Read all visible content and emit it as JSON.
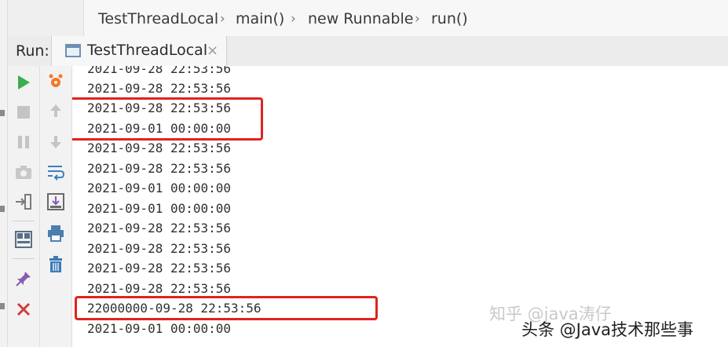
{
  "breadcrumb": {
    "items": [
      "TestThreadLocal",
      "main()",
      "new Runnable",
      "run()"
    ],
    "separator": "›"
  },
  "run_panel": {
    "label": "Run:",
    "tab_title": "TestThreadLocal",
    "tab_close": "×"
  },
  "toolbar_left": [
    {
      "icon": "run-icon",
      "color": "#3cae4c"
    },
    {
      "icon": "stop-icon",
      "color": "#b8b8b8"
    },
    {
      "icon": "pause-icon",
      "color": "#b8b8b8"
    },
    {
      "icon": "camera-icon",
      "color": "#b8b8b8"
    },
    {
      "icon": "login-icon",
      "color": "#777777"
    },
    {
      "icon": "layout-icon",
      "color": "#5a6f86"
    },
    {
      "icon": "pin-icon",
      "color": "#8a5ab0"
    },
    {
      "icon": "close-icon",
      "color": "#d23c3c"
    }
  ],
  "toolbar_right": [
    {
      "icon": "debug-icon",
      "color": "#f07a28"
    },
    {
      "icon": "up-arrow-icon",
      "color": "#b8b8b8"
    },
    {
      "icon": "down-arrow-icon",
      "color": "#b8b8b8"
    },
    {
      "icon": "soft-wrap-icon",
      "color": "#3f7fbf"
    },
    {
      "icon": "scroll-to-end-icon",
      "color": "#6a6a6a"
    },
    {
      "icon": "print-icon",
      "color": "#4a7fb0"
    },
    {
      "icon": "trash-icon",
      "color": "#3d7ab8"
    }
  ],
  "console": {
    "lines": [
      "2021-09-28 22:53:56",
      "2021-09-28 22:53:56",
      "2021-09-28 22:53:56",
      "2021-09-01 00:00:00",
      "2021-09-28 22:53:56",
      "2021-09-28 22:53:56",
      "2021-09-01 00:00:00",
      "2021-09-01 00:00:00",
      "2021-09-28 22:53:56",
      "2021-09-28 22:53:56",
      "2021-09-28 22:53:56",
      "2021-09-28 22:53:56",
      "22000000-09-28 22:53:56",
      "2021-09-01 00:00:00"
    ],
    "highlight_color": "#e0231f"
  },
  "watermarks": {
    "zhihu": "知乎 @java涛仔",
    "toutiao": "头条 @Java技术那些事"
  }
}
